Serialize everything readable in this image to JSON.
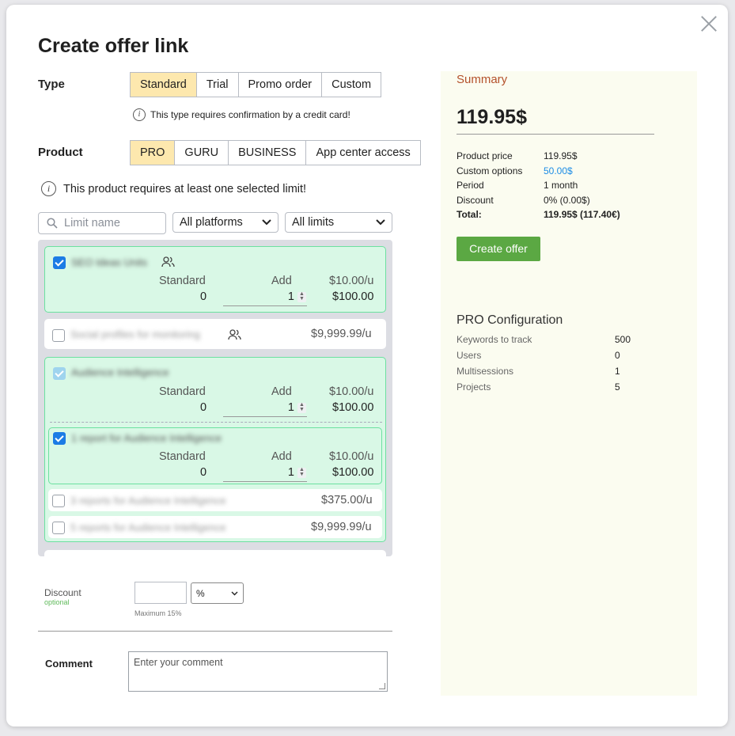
{
  "title": "Create offer link",
  "type_label": "Type",
  "type_options": [
    "Standard",
    "Trial",
    "Promo order",
    "Custom"
  ],
  "type_note": "This type requires confirmation by a credit card!",
  "product_label": "Product",
  "product_options": [
    "PRO",
    "GURU",
    "BUSINESS",
    "App center access"
  ],
  "product_note": "This product requires at least one selected limit!",
  "filters": {
    "search_placeholder": "Limit name",
    "platforms": "All platforms",
    "limits": "All limits"
  },
  "columns": {
    "standard": "Standard",
    "add": "Add"
  },
  "limits": [
    {
      "name": "SEO Ideas Units",
      "standard": "0",
      "add": "1",
      "unit_price": "$10.00/u",
      "total": "$100.00"
    },
    {
      "name": "Social profiles for monitoring",
      "price": "$9,999.99/u"
    },
    {
      "name": "Audience Intelligence",
      "standard": "0",
      "add": "1",
      "unit_price": "$10.00/u",
      "total": "$100.00"
    },
    {
      "name": "1 report for Audience Intelligence",
      "standard": "0",
      "add": "1",
      "unit_price": "$10.00/u",
      "total": "$100.00"
    },
    {
      "name": "3 reports for Audience Intelligence",
      "price": "$375.00/u"
    },
    {
      "name": "5 reports for Audience Intelligence",
      "price": "$9,999.99/u"
    }
  ],
  "discount": {
    "label": "Discount",
    "optional": "optional",
    "unit": "%",
    "max": "Maximum 15%"
  },
  "comment": {
    "label": "Comment",
    "placeholder": "Enter your comment"
  },
  "summary": {
    "title": "Summary",
    "price": "119.95$",
    "rows": [
      {
        "k": "Product price",
        "v": "119.95$"
      },
      {
        "k": "Custom options",
        "v": "50.00$"
      },
      {
        "k": "Period",
        "v": "1 month"
      },
      {
        "k": "Discount",
        "v": "0% (0.00$)"
      },
      {
        "k": "Total:",
        "v": "119.95$ (117.40€)"
      }
    ],
    "create_button": "Create offer"
  },
  "config": {
    "title": "PRO Configuration",
    "rows": [
      {
        "k": "Keywords to track",
        "v": "500"
      },
      {
        "k": "Users",
        "v": "0"
      },
      {
        "k": "Multisessions",
        "v": "1"
      },
      {
        "k": "Projects",
        "v": "5"
      }
    ]
  },
  "colors": {
    "accent_tab": "#fde8ae",
    "green_card": "#d9f8e6",
    "button": "#5ba843",
    "summary_title": "#b4512b",
    "link": "#1c8ce5"
  }
}
